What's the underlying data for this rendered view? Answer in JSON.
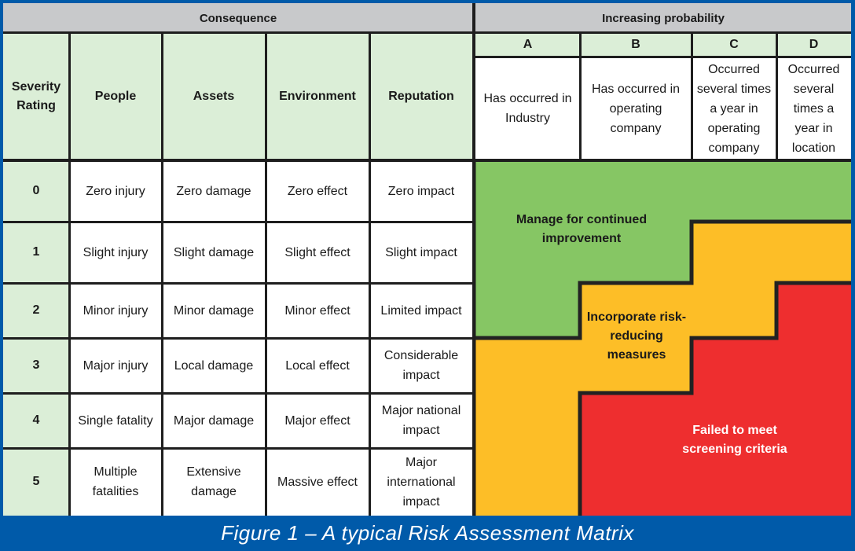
{
  "consequence_header": "Consequence",
  "probability_header": "Increasing probability",
  "columns": {
    "severity": "Severity Rating",
    "people": "People",
    "assets": "Assets",
    "environment": "Environment",
    "reputation": "Reputation"
  },
  "probability": [
    {
      "letter": "A",
      "description": "Has occurred in Industry"
    },
    {
      "letter": "B",
      "description": "Has occurred in operating company"
    },
    {
      "letter": "C",
      "description": "Occurred several times a year in operating company"
    },
    {
      "letter": "D",
      "description": "Occurred several times a year in location"
    }
  ],
  "rows": [
    {
      "severity": "0",
      "people": "Zero injury",
      "assets": "Zero damage",
      "environment": "Zero effect",
      "reputation": "Zero impact"
    },
    {
      "severity": "1",
      "people": "Slight injury",
      "assets": "Slight damage",
      "environment": "Slight effect",
      "reputation": "Slight impact"
    },
    {
      "severity": "2",
      "people": "Minor injury",
      "assets": "Minor damage",
      "environment": "Minor effect",
      "reputation": "Limited impact"
    },
    {
      "severity": "3",
      "people": "Major injury",
      "assets": "Local damage",
      "environment": "Local effect",
      "reputation": "Considerable impact"
    },
    {
      "severity": "4",
      "people": "Single fatality",
      "assets": "Major damage",
      "environment": "Major effect",
      "reputation": "Major national impact"
    },
    {
      "severity": "5",
      "people": "Multiple fatalities",
      "assets": "Extensive damage",
      "environment": "Massive effect",
      "reputation": "Major international impact"
    }
  ],
  "zones": [
    {
      "name": "low",
      "label": "Manage for continued improvement",
      "color": "#86c664",
      "text_color": "#1a1a1a",
      "cells": [
        "0A",
        "0B",
        "0C",
        "0D",
        "1A",
        "1B",
        "1C",
        "2A",
        "2B",
        "3A"
      ]
    },
    {
      "name": "medium",
      "label": "Incorporate risk-reducing measures",
      "color": "#fdbe27",
      "text_color": "#1a1a1a",
      "cells": [
        "1D",
        "2C",
        "2D",
        "3B",
        "3C",
        "4A",
        "4B",
        "5A"
      ]
    },
    {
      "name": "high",
      "label": "Failed to meet screening criteria",
      "color": "#ee2e2f",
      "text_color": "#ffffff",
      "cells": [
        "3D",
        "4C",
        "4D",
        "5B",
        "5C",
        "5D"
      ]
    }
  ],
  "caption": "Figure 1 – A typical Risk Assessment Matrix",
  "colors": {
    "frame": "#005aa9",
    "header_gray": "#c8c9cb",
    "header_green": "#dbeed7"
  }
}
